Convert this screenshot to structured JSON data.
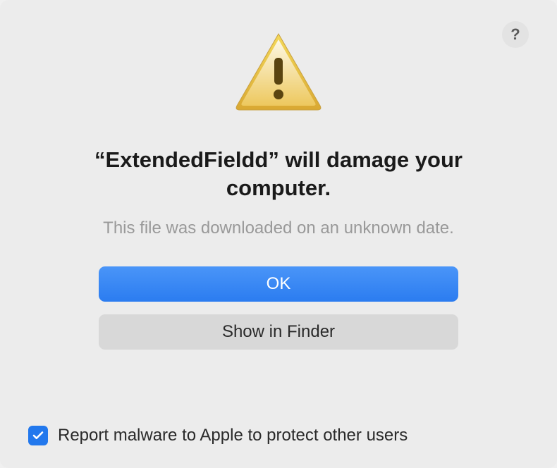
{
  "dialog": {
    "help_tooltip": "?",
    "title": "“ExtendedFieldd” will damage your computer.",
    "subtitle": "This file was downloaded on an unknown date.",
    "primary_button_label": "OK",
    "secondary_button_label": "Show in Finder",
    "checkbox_label": "Report malware to Apple to protect other users",
    "checkbox_checked": true
  }
}
